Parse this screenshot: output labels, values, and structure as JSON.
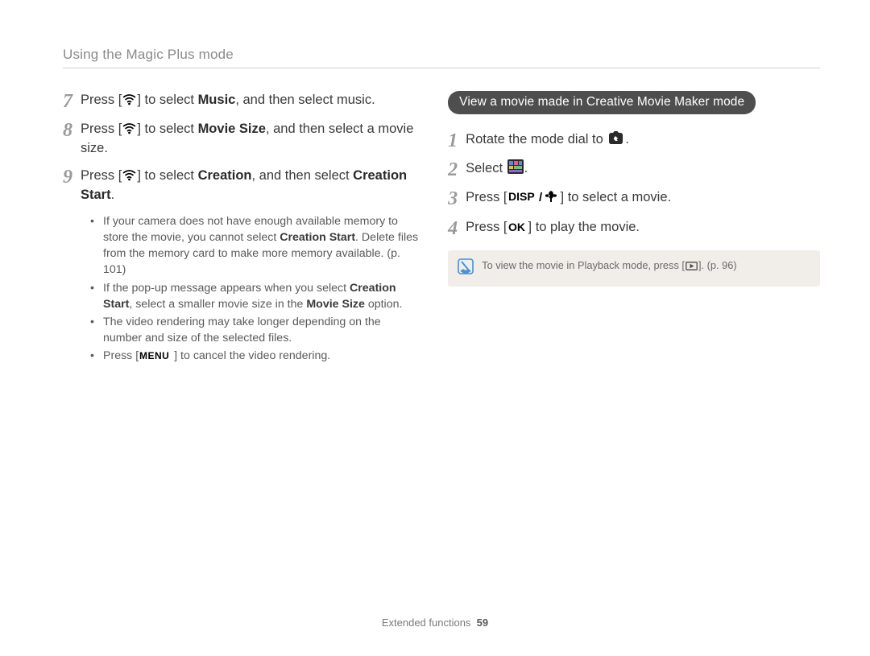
{
  "header": {
    "title": "Using the Magic Plus mode"
  },
  "left": {
    "steps": [
      {
        "num": "7",
        "pre": "Press [",
        "mid": "] to select ",
        "bold1": "Music",
        "post": ", and then select music."
      },
      {
        "num": "8",
        "pre": "Press [",
        "mid": "] to select ",
        "bold1": "Movie Size",
        "post": ", and then select a movie size."
      },
      {
        "num": "9",
        "pre": "Press [",
        "mid": "] to select ",
        "bold1": "Creation",
        "post": ", and then select ",
        "bold2": "Creation Start",
        "post2": "."
      }
    ],
    "bullets": [
      {
        "t1": "If your camera does not have enough available memory to store the movie, you cannot select ",
        "b1": "Creation Start",
        "t2": ". Delete files from the memory card to make more memory available. (p. 101)"
      },
      {
        "t1": "If the pop-up message appears when you select ",
        "b1": "Creation Start",
        "t2": ", select a smaller movie size in the ",
        "b2": "Movie Size",
        "t3": " option."
      },
      {
        "t1": "The video rendering may take longer depending on the number and size of the selected files."
      },
      {
        "t1": "Press [",
        "t2": "] to cancel the video rendering."
      }
    ]
  },
  "right": {
    "pill": "View a movie made in Creative Movie Maker mode",
    "steps": [
      {
        "num": "1",
        "t1": "Rotate the mode dial to ",
        "t2": "."
      },
      {
        "num": "2",
        "t1": "Select ",
        "t2": "."
      },
      {
        "num": "3",
        "t1": "Press [",
        "t2": "] to select a movie."
      },
      {
        "num": "4",
        "t1": "Press [",
        "t2": "] to play the movie."
      }
    ],
    "note": {
      "t1": "To view the movie in Playback mode, press [",
      "t2": "]. (p. 96)"
    }
  },
  "footer": {
    "section": "Extended functions",
    "page": "59"
  }
}
